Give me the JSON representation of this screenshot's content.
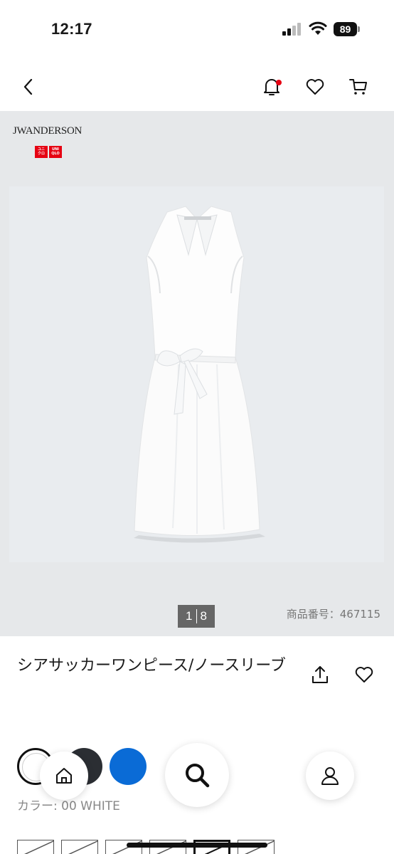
{
  "status_bar": {
    "time": "12:17",
    "battery": "89"
  },
  "header": {
    "back_icon": "chevron-left-icon",
    "bell_icon": "bell-icon",
    "heart_icon": "heart-icon",
    "cart_icon": "cart-icon",
    "notification_color": "#e60012"
  },
  "hero": {
    "brand_name": "JWANDERSON",
    "logo_text": [
      "ユニクロ",
      "UNIQLO"
    ],
    "image_description_icon": "white-sleeveless-shirt-dress-photo",
    "pager_current": "1",
    "pager_total": "8",
    "product_number": "商品番号：467115"
  },
  "product": {
    "title": "シアサッカーワンピース/ノースリーブ",
    "share_icon": "share-icon",
    "favorite_icon": "heart-icon"
  },
  "colors": {
    "swatches": [
      {
        "name": "white",
        "hex": "#ffffff",
        "selected": true
      },
      {
        "name": "black",
        "hex": "#2b2e33",
        "selected": false
      },
      {
        "name": "blue",
        "hex": "#0a6bd6",
        "selected": false
      }
    ],
    "label": "カラー: 00 WHITE"
  },
  "bottom_nav": {
    "home_icon": "home-icon",
    "search_icon": "search-icon",
    "account_icon": "user-icon"
  }
}
